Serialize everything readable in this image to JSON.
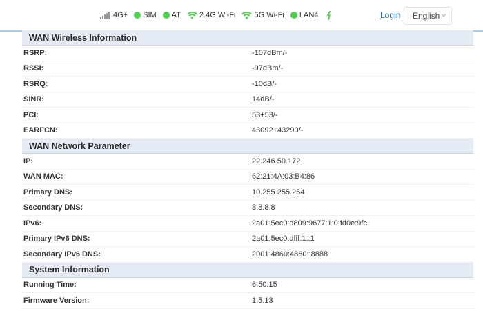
{
  "status_bar": [
    {
      "label": "4G+",
      "icon": "signal-bars-icon"
    },
    {
      "label": "SIM",
      "icon": "green-dot-icon"
    },
    {
      "label": "AT",
      "icon": "green-dot-icon"
    },
    {
      "label": "2.4G Wi-Fi",
      "icon": "wifi-icon"
    },
    {
      "label": "5G Wi-Fi",
      "icon": "wifi-icon"
    },
    {
      "label": "LAN4",
      "icon": "green-dot-icon"
    }
  ],
  "header": {
    "login_label": "Login",
    "language": "English"
  },
  "colors": {
    "accent_green": "#4cd14c",
    "link_blue": "#1d6fc4",
    "section_bg": "#e5ebf4"
  },
  "sections": [
    {
      "title": "WAN Wireless Information",
      "rows": [
        {
          "label": "RSRP:",
          "value": "-107dBm/-"
        },
        {
          "label": "RSSI:",
          "value": "-97dBm/-"
        },
        {
          "label": "RSRQ:",
          "value": "-10dB/-"
        },
        {
          "label": "SINR:",
          "value": "14dB/-"
        },
        {
          "label": "PCI:",
          "value": "53+53/-"
        },
        {
          "label": "EARFCN:",
          "value": "43092+43290/-"
        }
      ]
    },
    {
      "title": "WAN Network Parameter",
      "rows": [
        {
          "label": "IP:",
          "value": "22.246.50.172"
        },
        {
          "label": "WAN MAC:",
          "value": "62:21:4A:03:B4:86"
        },
        {
          "label": "Primary DNS:",
          "value": "10.255.255.254"
        },
        {
          "label": "Secondary DNS:",
          "value": "8.8.8.8"
        },
        {
          "label": "IPv6:",
          "value": "2a01:5ec0:d809:9677:1:0:fd0e:9fc"
        },
        {
          "label": "Primary IPv6 DNS:",
          "value": "2a01:5ec0:dfff:1::1"
        },
        {
          "label": "Secondary IPv6 DNS:",
          "value": "2001:4860:4860::8888"
        }
      ]
    },
    {
      "title": "System Information",
      "rows": [
        {
          "label": "Running Time:",
          "value": "6:50:15"
        },
        {
          "label": "Firmware Version:",
          "value": "1.5.13"
        }
      ]
    }
  ]
}
